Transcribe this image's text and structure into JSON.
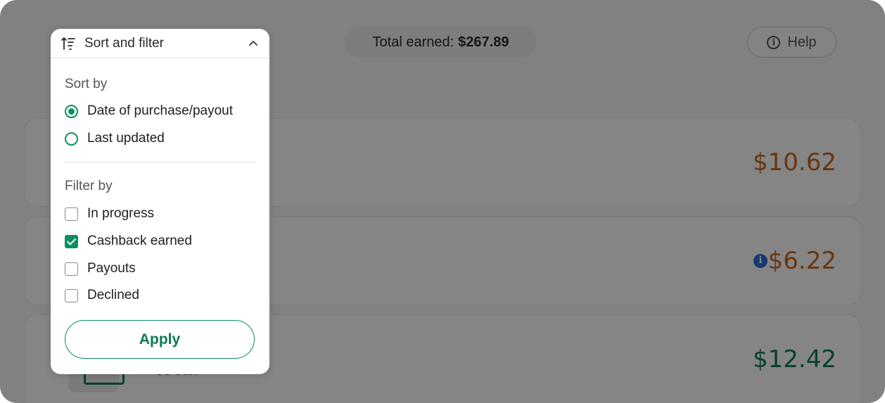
{
  "topbar": {
    "total_label": "Total earned:",
    "total_value": "$267.89",
    "help_label": "Help"
  },
  "cards": [
    {
      "amount": "$10.62",
      "amount_color": "#c9661a"
    },
    {
      "amount": "$6.22",
      "amount_color": "#c9661a",
      "has_info": true
    },
    {
      "amount": "$12.42",
      "amount_color": "#0d7a52",
      "date_partial": "03 Jan"
    }
  ],
  "panel": {
    "title": "Sort and filter",
    "sort_label": "Sort by",
    "sort_options": [
      {
        "label": "Date of purchase/payout",
        "selected": true
      },
      {
        "label": "Last updated",
        "selected": false
      }
    ],
    "filter_label": "Filter by",
    "filter_options": [
      {
        "label": "In progress",
        "checked": false
      },
      {
        "label": "Cashback earned",
        "checked": true
      },
      {
        "label": "Payouts",
        "checked": false
      },
      {
        "label": "Declined",
        "checked": false
      }
    ],
    "apply_label": "Apply"
  },
  "colors": {
    "accent": "#0d8f66",
    "orange": "#c9661a",
    "info_blue": "#2f6fd6"
  }
}
